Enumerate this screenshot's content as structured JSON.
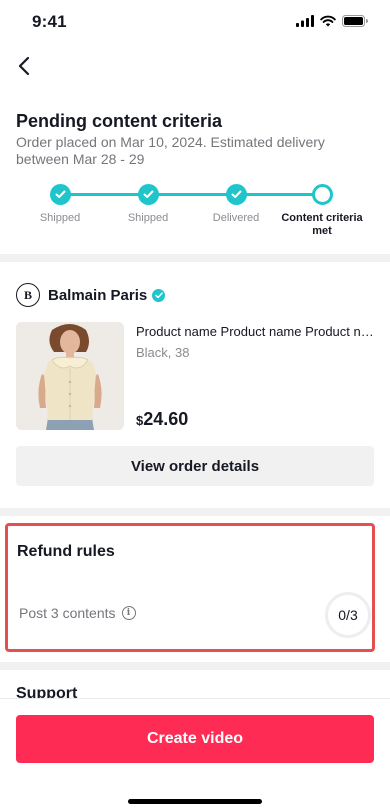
{
  "status_bar": {
    "time": "9:41"
  },
  "header": {
    "title": "Pending content criteria",
    "description": "Order placed on Mar 10, 2024. Estimated delivery between Mar 28 - 29"
  },
  "progress": {
    "steps": [
      {
        "label": "Shipped",
        "state": "done"
      },
      {
        "label": "Shipped",
        "state": "done"
      },
      {
        "label": "Delivered",
        "state": "done"
      },
      {
        "label": "Content criteria met",
        "state": "current"
      }
    ]
  },
  "shop": {
    "name": "Balmain Paris",
    "logo_text": "B",
    "verified": true
  },
  "product": {
    "name": "Product name Product name Product name",
    "variant": "Black, 38",
    "currency": "$",
    "price": "24.60"
  },
  "view_order_label": "View order details",
  "refund": {
    "title": "Refund rules",
    "rule_label": "Post 3 contents",
    "progress_text": "0/3"
  },
  "support": {
    "title": "Support"
  },
  "create_video_label": "Create video",
  "colors": {
    "accent": "#20c4cb",
    "primary_button": "#fe2c55",
    "highlight_border": "#e4504f"
  }
}
